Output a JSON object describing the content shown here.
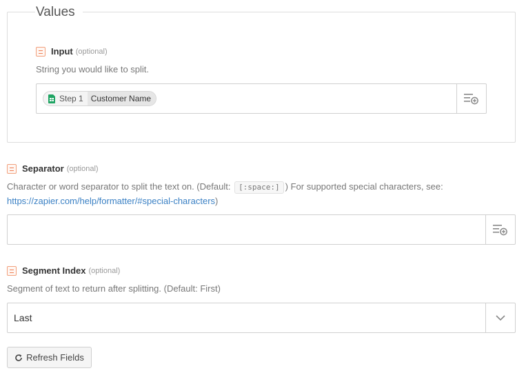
{
  "values_section": {
    "legend": "Values"
  },
  "input_field": {
    "label": "Input",
    "optional": "(optional)",
    "help": "String you would like to split.",
    "pill": {
      "step": "Step 1",
      "name": "Customer Name",
      "icon": "google-sheets-icon"
    }
  },
  "separator_field": {
    "label": "Separator",
    "optional": "(optional)",
    "help_before": "Character or word separator to split the text on. (Default:",
    "help_code": "[:space:]",
    "help_after": ") For supported special characters, see:",
    "help_link": "https://zapier.com/help/formatter/#special-characters",
    "help_end": ")",
    "value": ""
  },
  "segment_field": {
    "label": "Segment Index",
    "optional": "(optional)",
    "help": "Segment of text to return after splitting. (Default: First)",
    "selected": "Last"
  },
  "refresh_button": {
    "label": "Refresh Fields"
  },
  "colors": {
    "link": "#3a80c4",
    "field_icon": "#ef7d52",
    "sheets_green": "#1fa463"
  }
}
